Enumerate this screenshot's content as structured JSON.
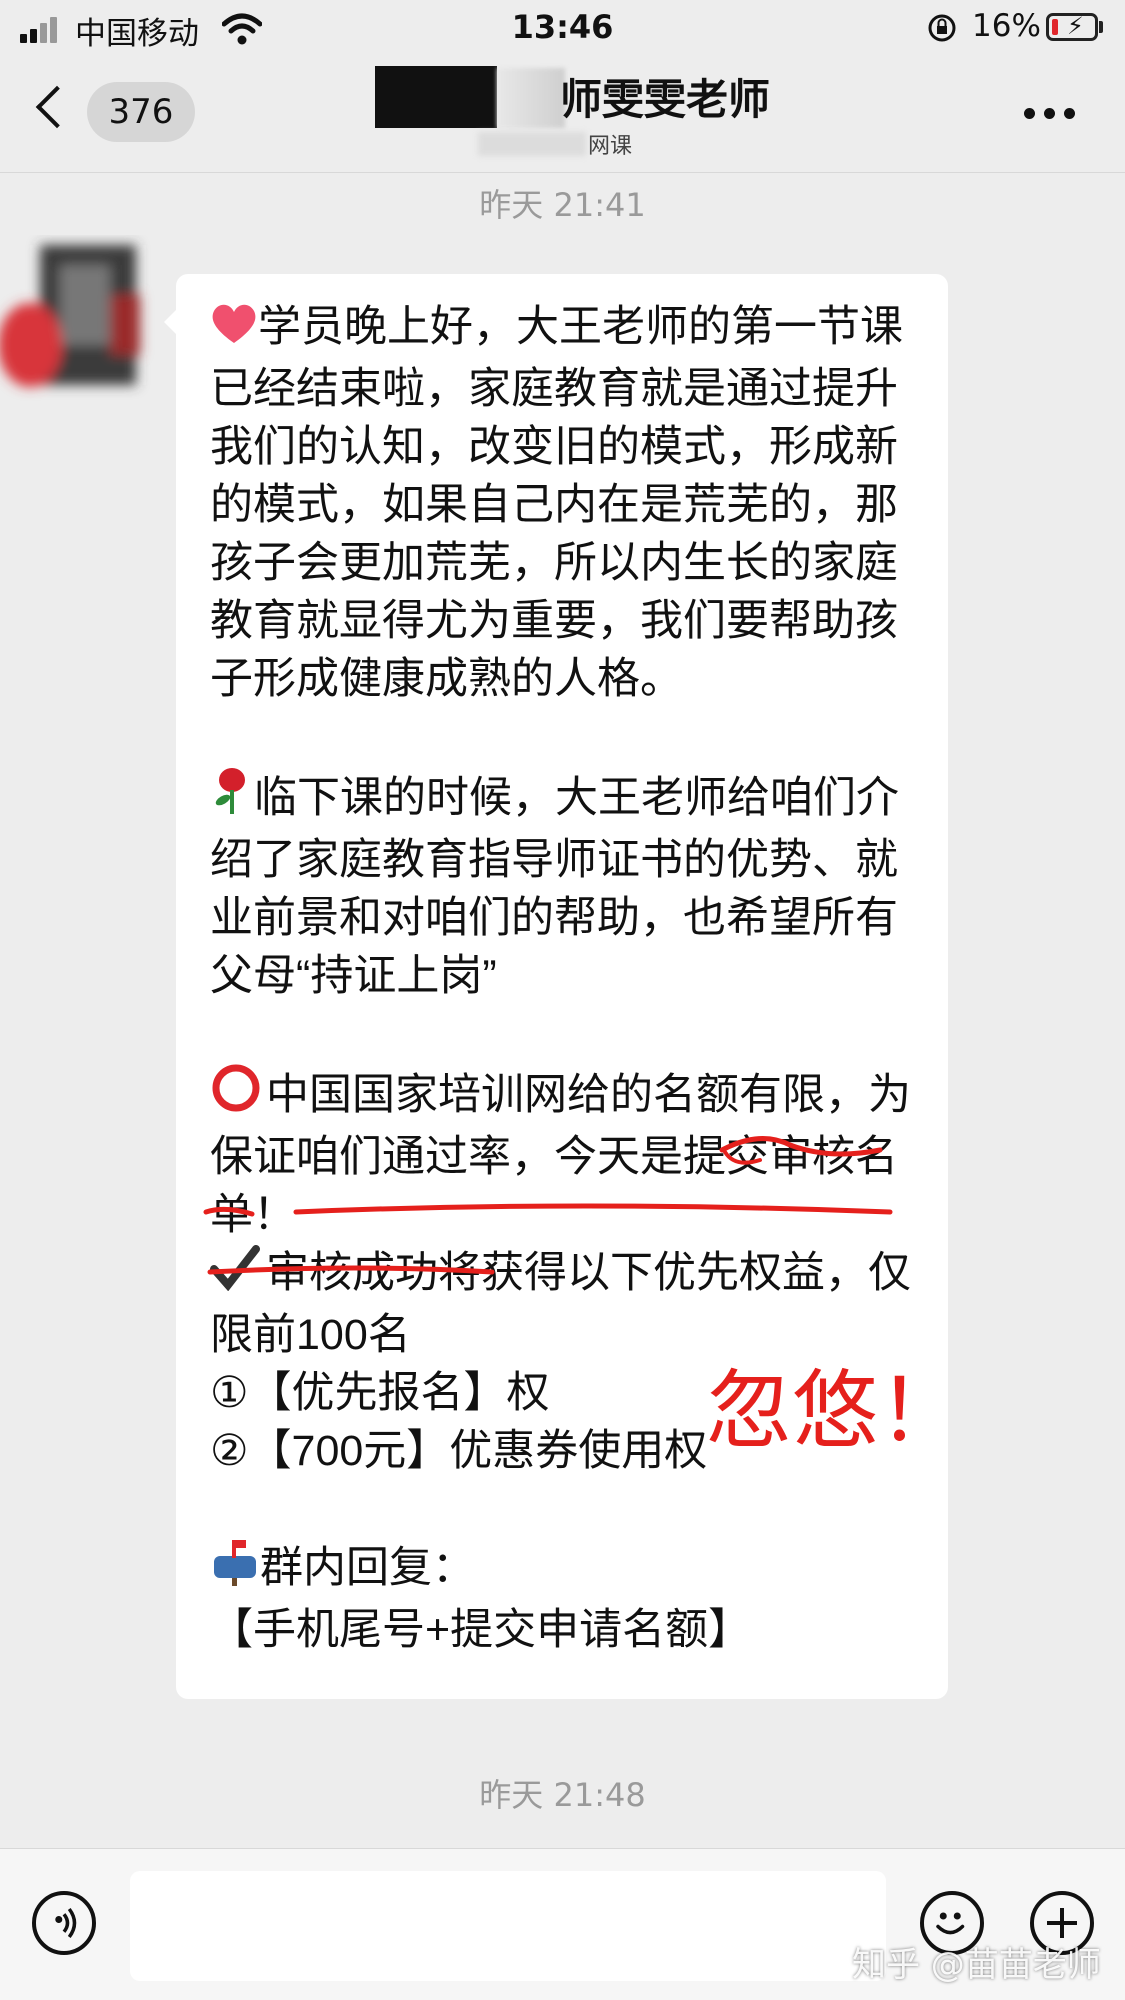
{
  "status_bar": {
    "carrier": "中国移动",
    "time": "13:46",
    "battery_percent": "16%",
    "battery_level": 0.16,
    "battery_color": "#e0262b"
  },
  "header": {
    "unread_count": "376",
    "title_visible": "师雯雯老师",
    "subtitle_visible": "网课"
  },
  "messages": {
    "timestamp_top": "昨天 21:41",
    "body": "学员晚上好，大王老师的第一节课已经结束啦，家庭教育就是通过提升我们的认知，改变旧的模式，形成新的模式，如果自己内在是荒芜的，那孩子会更加荒芜，所以内生长的家庭教育就显得尤为重要，我们要帮助孩子形成健康成熟的人格。\n\n临下课的时候，大王老师给咱们介绍了家庭教育指导师证书的优势、就业前景和对咱们的帮助，也希望所有父母“持证上岗”\n\n中国国家培训网给的名额有限，为保证咱们通过率，今天是提交审核名单！\n审核成功将获得以下优先权益，仅限前100名\n①【优先报名】权\n②【700元】优惠券使用权\n\n群内回复：\n【手机尾号+提交申请名额】",
    "para1": "学员晚上好，大王老师的第一节课已经结束啦，家庭教育就是通过提升我们的认知，改变旧的模式，形成新的模式，如果自己内在是荒芜的，那孩子会更加荒芜，所以内生长的家庭教育就显得尤为重要，我们要帮助孩子形成健康成熟的人格。",
    "para2": "临下课的时候，大王老师给咱们介绍了家庭教育指导师证书的优势、就业前景和对咱们的帮助，也希望所有父母“持证上岗”",
    "para3": "中国国家培训网给的名额有限，为保证咱们通过率，今天是提交审核名单！",
    "para4": "审核成功将获得以下优先权益，仅限前100名",
    "item1": "①【优先报名】权",
    "item2": "②【700元】优惠券使用权",
    "reply_label": "群内回复：",
    "reply_format": "【手机尾号+提交申请名额】",
    "annotation": "忽悠！",
    "annotation_color": "#e5201c",
    "timestamp_bottom": "昨天 21:48"
  },
  "icons": {
    "para1": "red-heart-icon",
    "para2": "rose-icon",
    "para3": "red-circle-icon",
    "para4": "check-mark-icon",
    "reply": "mailbox-icon"
  },
  "watermark": "知乎 @苗苗老师"
}
